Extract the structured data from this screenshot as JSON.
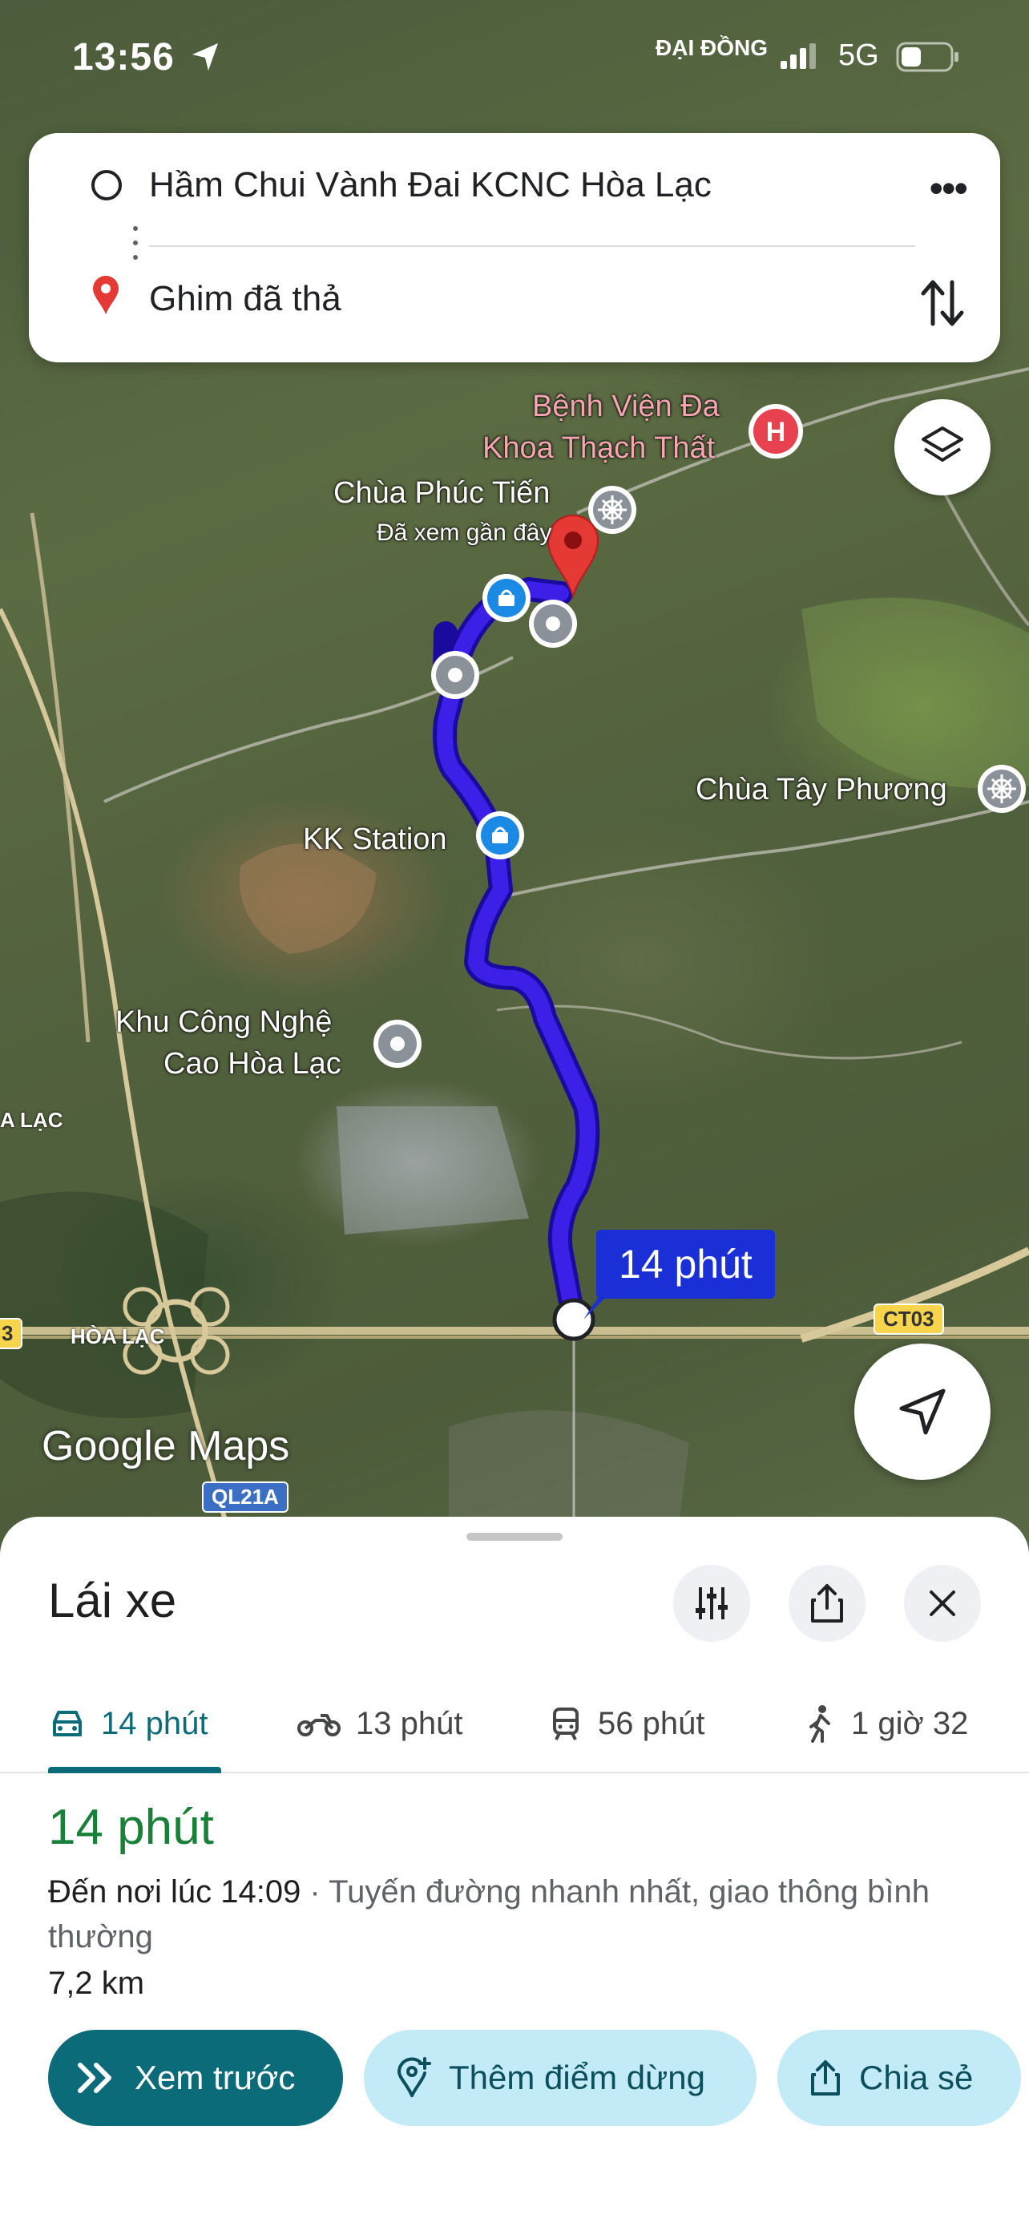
{
  "status_bar": {
    "time": "13:56",
    "carrier": "ĐẠI ĐỒNG",
    "network": "5G"
  },
  "search": {
    "origin": "Hầm Chui Vành Đai KCNC Hòa Lạc",
    "destination": "Ghim đã thả"
  },
  "map": {
    "places": {
      "hospital": [
        "Bệnh Viện Đa",
        "Khoa Thạch Thất"
      ],
      "pagoda1": "Chùa Phúc Tiến",
      "pagoda1_sub": "Đã xem gần đây",
      "pagoda2": "Chùa Tây Phương",
      "station": "KK Station",
      "tech_park": [
        "Khu Công Nghệ",
        "Cao Hòa Lạc"
      ],
      "area1": "HÒA LẠC",
      "area2": "A LẠC"
    },
    "shields": {
      "ct03": "CT03",
      "ql21a": "QL21A",
      "left": "3"
    },
    "logo": "Google Maps",
    "route_time": "14 phút",
    "route_color": "#3d20e8"
  },
  "sheet": {
    "title": "Lái xe",
    "tabs": [
      {
        "icon": "car-icon",
        "label": "14 phút"
      },
      {
        "icon": "motorbike-icon",
        "label": "13 phút"
      },
      {
        "icon": "train-icon",
        "label": "56 phút"
      },
      {
        "icon": "walk-icon",
        "label": "1 giờ 32"
      }
    ],
    "duration": "14 phút",
    "arrive": "Đến nơi lúc 14:09",
    "arrive_note": " · Tuyến đường nhanh nhất, giao thông bình thường",
    "distance": "7,2 km",
    "buttons": {
      "preview": "Xem trước",
      "add_stop": "Thêm điểm dừng",
      "share": "Chia sẻ"
    }
  },
  "colors": {
    "accent": "#0b6b78",
    "duration_green": "#188038",
    "pin_red": "#e53935"
  }
}
